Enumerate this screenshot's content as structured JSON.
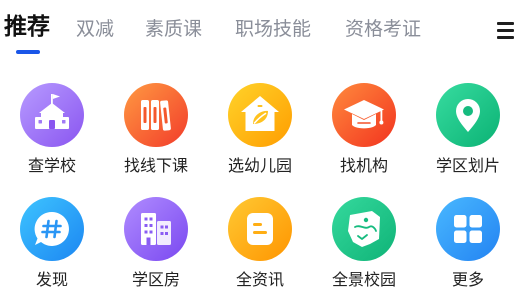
{
  "tabs": [
    {
      "label": "推荐",
      "active": true
    },
    {
      "label": "双减",
      "active": false
    },
    {
      "label": "素质课",
      "active": false
    },
    {
      "label": "职场技能",
      "active": false
    },
    {
      "label": "资格考证",
      "active": false
    }
  ],
  "menu": {
    "icon": "hamburger-menu-icon"
  },
  "colors": {
    "accent": "#1a56e8",
    "tab_active": "#111111",
    "tab_inactive": "#8a8e99",
    "label": "#222222"
  },
  "grid": {
    "items": [
      {
        "label": "查学校",
        "icon": "school-building-icon",
        "color": "#9b6ff7"
      },
      {
        "label": "找线下课",
        "icon": "books-icon",
        "color": "#f5562d"
      },
      {
        "label": "选幼儿园",
        "icon": "kindergarten-house-icon",
        "color": "#ffb30f"
      },
      {
        "label": "找机构",
        "icon": "graduation-cap-icon",
        "color": "#f4512a"
      },
      {
        "label": "学区划片",
        "icon": "location-pin-icon",
        "color": "#1cc586"
      },
      {
        "label": "发现",
        "icon": "hashtag-bubble-icon",
        "color": "#26a2f8"
      },
      {
        "label": "学区房",
        "icon": "apartment-buildings-icon",
        "color": "#9066f5"
      },
      {
        "label": "全资讯",
        "icon": "news-note-icon",
        "color": "#ffaa14"
      },
      {
        "label": "全景校园",
        "icon": "panorama-map-icon",
        "color": "#1ec387"
      },
      {
        "label": "更多",
        "icon": "grid-apps-icon",
        "color": "#2e9bf6"
      }
    ]
  }
}
